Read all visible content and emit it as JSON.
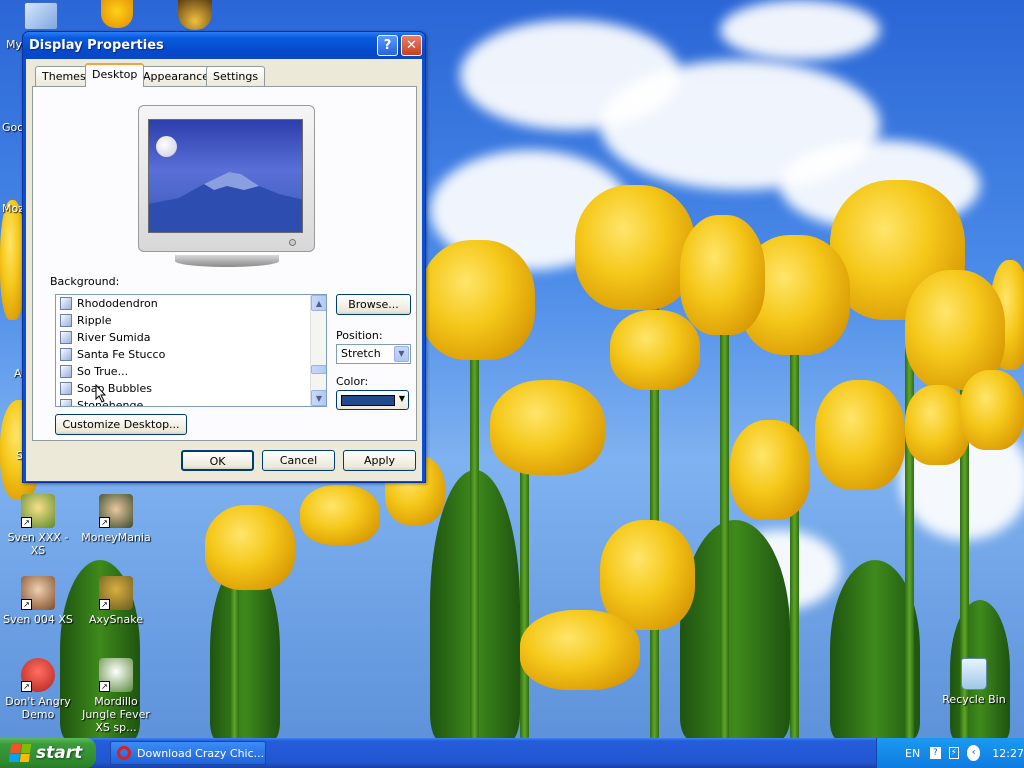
{
  "desktop": {
    "icons_left_partial": [
      "My",
      "Goo",
      "Moz",
      "A",
      "S"
    ],
    "icons": [
      {
        "label": "Sven XXX - XS",
        "icon": "sven-xxx-icon"
      },
      {
        "label": "MoneyMania",
        "icon": "moneymania-icon"
      },
      {
        "label": "Sven 004 XS",
        "icon": "sven-004-icon"
      },
      {
        "label": "AxySnake",
        "icon": "axysnake-icon"
      },
      {
        "label": "Don't Angry Demo",
        "icon": "dont-angry-icon"
      },
      {
        "label": "Mordillo Jungle Fever XS sp...",
        "icon": "mordillo-icon"
      },
      {
        "label": "Recycle Bin",
        "icon": "recycle-bin-icon"
      }
    ]
  },
  "window": {
    "title": "Display Properties",
    "tabs": [
      "Themes",
      "Desktop",
      "Appearance",
      "Settings"
    ],
    "active_tab": "Desktop",
    "background_label": "Background:",
    "background_items": [
      "Rhododendron",
      "Ripple",
      "River Sumida",
      "Santa Fe Stucco",
      "So True...",
      "Soap Bubbles",
      "Stonehenge"
    ],
    "browse_label": "Browse...",
    "position_label": "Position:",
    "position_value": "Stretch",
    "color_label": "Color:",
    "color_value": "#1f4a8c",
    "customize_label": "Customize Desktop...",
    "ok_label": "OK",
    "cancel_label": "Cancel",
    "apply_label": "Apply"
  },
  "taskbar": {
    "start_label": "start",
    "task_label": "Download Crazy Chic...",
    "language": "EN",
    "clock": "12:27"
  }
}
